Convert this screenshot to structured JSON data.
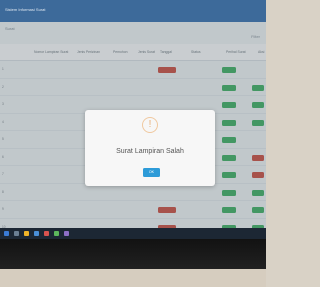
{
  "app": {
    "title": "Sistem Informasi Surat"
  },
  "toolbar": {
    "menu": "Surat",
    "filter_label": "Filter"
  },
  "table": {
    "headers": [
      "Nomor Lampiran Surat",
      "Jenis Perizinan",
      "Pemohon",
      "Jenis Surat",
      "Tanggal",
      "Status",
      "Perihal Surat",
      "Aksi"
    ],
    "rows": [
      {
        "no": "1",
        "nomor": "",
        "jenis": "",
        "pemohon": "",
        "status": "",
        "perihal": "",
        "aksi": ""
      },
      {
        "no": "2",
        "nomor": "",
        "jenis": "",
        "pemohon": "",
        "status": "",
        "perihal": "",
        "aksi": ""
      },
      {
        "no": "3",
        "nomor": "",
        "jenis": "",
        "pemohon": "",
        "status": "",
        "perihal": "",
        "aksi": ""
      },
      {
        "no": "4",
        "nomor": "",
        "jenis": "",
        "pemohon": "",
        "status": "",
        "perihal": "",
        "aksi": ""
      },
      {
        "no": "5",
        "nomor": "",
        "jenis": "",
        "pemohon": "",
        "status": "",
        "perihal": "",
        "aksi": ""
      },
      {
        "no": "6",
        "nomor": "",
        "jenis": "",
        "pemohon": "",
        "status": "",
        "perihal": "",
        "aksi": ""
      },
      {
        "no": "7",
        "nomor": "",
        "jenis": "",
        "pemohon": "",
        "status": "",
        "perihal": "",
        "aksi": ""
      },
      {
        "no": "8",
        "nomor": "",
        "jenis": "",
        "pemohon": "",
        "status": "",
        "perihal": "",
        "aksi": ""
      },
      {
        "no": "9",
        "nomor": "",
        "jenis": "",
        "pemohon": "",
        "status": "",
        "perihal": "",
        "aksi": ""
      },
      {
        "no": "10",
        "nomor": "",
        "jenis": "",
        "pemohon": "",
        "status": "",
        "perihal": "",
        "aksi": ""
      }
    ]
  },
  "dialog": {
    "icon": "warning-icon",
    "title": "Surat Lampiran Salah",
    "message": "",
    "ok_label": "OK"
  },
  "colors": {
    "accent": "#2d9bd8",
    "status_red": "#c0392b",
    "status_green": "#27a351"
  }
}
